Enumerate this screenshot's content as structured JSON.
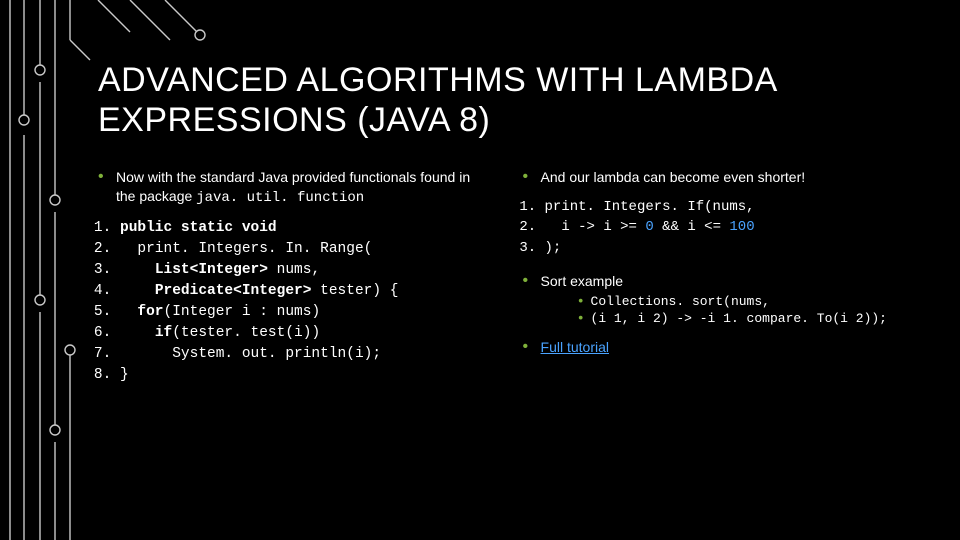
{
  "title": "ADVANCED ALGORITHMS WITH LAMBDA EXPRESSIONS (JAVA 8)",
  "left": {
    "bullet_text": "Now with the standard Java provided functionals found in the package ",
    "bullet_mono": "java. util. function",
    "code": [
      "public static void",
      "  print. Integers. In. Range(",
      "    List<Integer> nums,",
      "    Predicate<Integer> tester) {",
      "  for(Integer i : nums)",
      "    if(tester. test(i))",
      "      System. out. println(i);",
      "}"
    ]
  },
  "right": {
    "bullet_lambda": "And our lambda can become even shorter!",
    "lambda_code": [
      "print. Integers. If(nums,",
      "  i -> i >= 0 && i <= 100",
      ");"
    ],
    "bullet_sort": "Sort example",
    "sort_sub": [
      "Collections. sort(nums,",
      "  (i 1, i 2) -> -i 1. compare. To(i 2));"
    ],
    "link_text": "Full tutorial"
  }
}
